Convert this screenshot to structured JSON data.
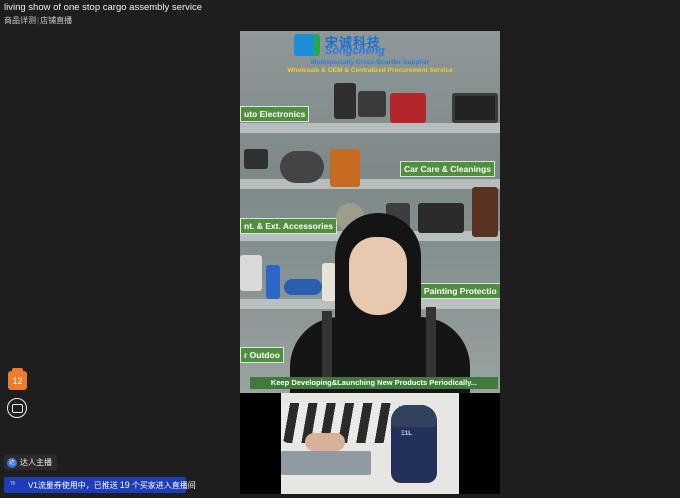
{
  "header": {
    "title": "living show of one stop cargo assembly service",
    "nav": [
      "商品详测",
      "店铺直播"
    ],
    "separator": "|"
  },
  "video": {
    "banner": {
      "brand_cn": "宋诚科技",
      "brand_en": "Songcheng",
      "tagline_1": "Multispecialty Cross-Boarder Supplier",
      "tagline_2": "Wholesale & OEM & Centralized Procurement Service",
      "categories": [
        "uto Electronics",
        "Car Care & Cleanings",
        "nt. & Ext. Accessories",
        "a: Painting Protectio",
        "r Outdoo"
      ],
      "footer": "Keep Developing&Launching New Products Periodically..."
    },
    "inset": {
      "device_label": "Ξ1L"
    }
  },
  "overlay": {
    "count_badge": "12",
    "anchor_tag_icon": "达",
    "anchor_tag_label": "达人主播",
    "traffic_icon": "ᵀᴮ",
    "traffic_prefix": "V1流量券使用中，已推送",
    "traffic_count": "19",
    "traffic_suffix": "个买家进入直播间"
  },
  "icons": {
    "count_badge": "bag-icon",
    "robot": "robot-icon",
    "anchor": "anchor-icon",
    "traffic": "ticket-icon"
  },
  "colors": {
    "traffic_bg": "#1d3cb8",
    "badge_orange": "#f07a2e",
    "shelf_green": "#4f8f3f"
  }
}
